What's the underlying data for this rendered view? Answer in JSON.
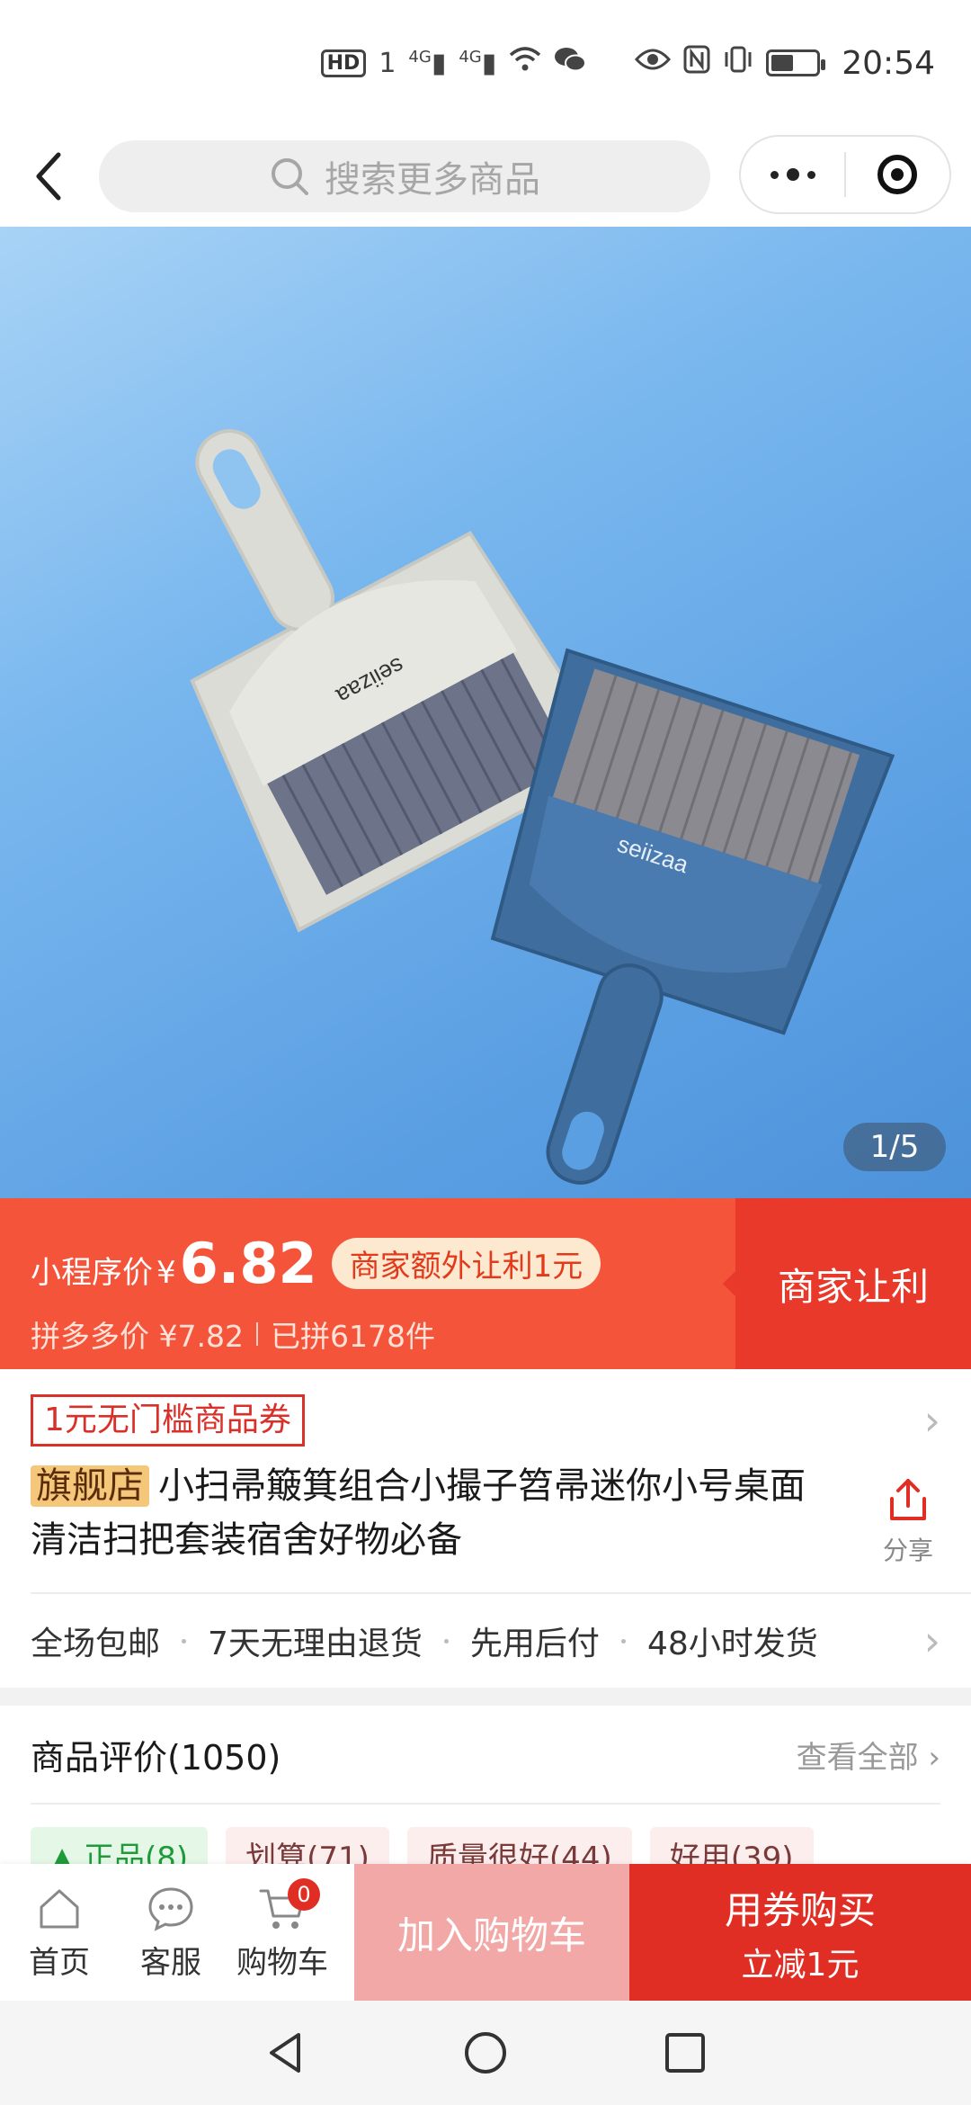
{
  "status_bar": {
    "time": "20:54",
    "network_1": "4G",
    "network_2": "4G",
    "hd_label": "HD",
    "sim_label": "1",
    "icons": [
      "hd-icon",
      "signal-icon",
      "signal-icon",
      "wifi-icon",
      "wechat-icon",
      "eye-icon",
      "nfc-icon",
      "vibrate-icon",
      "battery-icon"
    ]
  },
  "nav": {
    "search_placeholder": "搜索更多商品"
  },
  "gallery": {
    "counter": "1/5",
    "brand_mark": "seiizaa"
  },
  "price": {
    "label": "小程序价",
    "currency": "¥",
    "value": "6.82",
    "promo": "商家额外让利1元",
    "ref_label": "拼多多价",
    "ref_value": "¥7.82",
    "sold": "已拼6178件",
    "cta": "商家让利"
  },
  "product": {
    "coupon": "1元无门槛商品券",
    "badge": "旗舰店",
    "title": "小扫帚簸箕组合小撮子笤帚迷你小号桌面清洁扫把套装宿舍好物必备",
    "share_label": "分享"
  },
  "services": [
    "全场包邮",
    "7天无理由退货",
    "先用后付",
    "48小时发货"
  ],
  "reviews": {
    "title": "商品评价(1050)",
    "view_all": "查看全部",
    "tags": [
      {
        "label": "▲ 正品(8)"
      },
      {
        "label": "划算(71)"
      },
      {
        "label": "质量很好(44)"
      },
      {
        "label": "好用(39)"
      }
    ]
  },
  "bottom_bar": {
    "home": "首页",
    "service": "客服",
    "cart": "购物车",
    "cart_count": "0",
    "add_to_cart": "加入购物车",
    "buy": "用券购买",
    "buy_sub": "立减1元"
  },
  "colors": {
    "price_bg": "#f4553a",
    "cta_bg": "#e8392a",
    "buy_bg": "#e02e24",
    "add_cart_bg": "#f1a8a6"
  }
}
